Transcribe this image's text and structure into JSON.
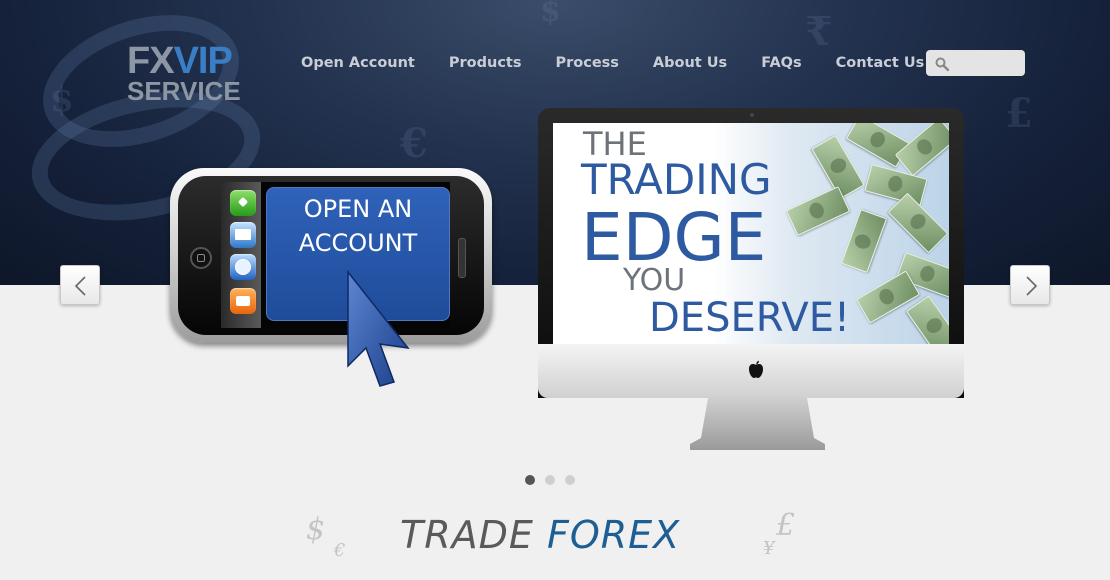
{
  "logo": {
    "line1_a": "FX",
    "line1_b": "VIP",
    "line2": "SERVICE"
  },
  "nav": {
    "items": [
      {
        "label": "Open Account"
      },
      {
        "label": "Products"
      },
      {
        "label": "Process"
      },
      {
        "label": "About Us"
      },
      {
        "label": "FAQs"
      },
      {
        "label": "Contact Us"
      }
    ]
  },
  "search": {
    "placeholder": "",
    "value": "",
    "icon": "search-icon"
  },
  "slider": {
    "prev_icon": "chevron-left-icon",
    "next_icon": "chevron-right-icon",
    "slide_count": 3,
    "active_slide": 1,
    "phone": {
      "cta_text": "OPEN AN\nACCOUNT",
      "dock_icons": [
        "phone-app-icon",
        "mail-app-icon",
        "safari-app-icon",
        "ipod-app-icon"
      ]
    },
    "monitor": {
      "line1": "THE",
      "line2": "TRADING",
      "line3": "EDGE",
      "line4": "YOU",
      "line5": "DESERVE!",
      "logo_icon": "apple-logo-icon"
    }
  },
  "tagline": {
    "word1": "TRADE",
    "word2": "FOREX"
  },
  "colors": {
    "header_dark": "#15213a",
    "nav_text": "#c9ced6",
    "brand_blue": "#2d5aa0",
    "forex_blue": "#1f5e93"
  }
}
